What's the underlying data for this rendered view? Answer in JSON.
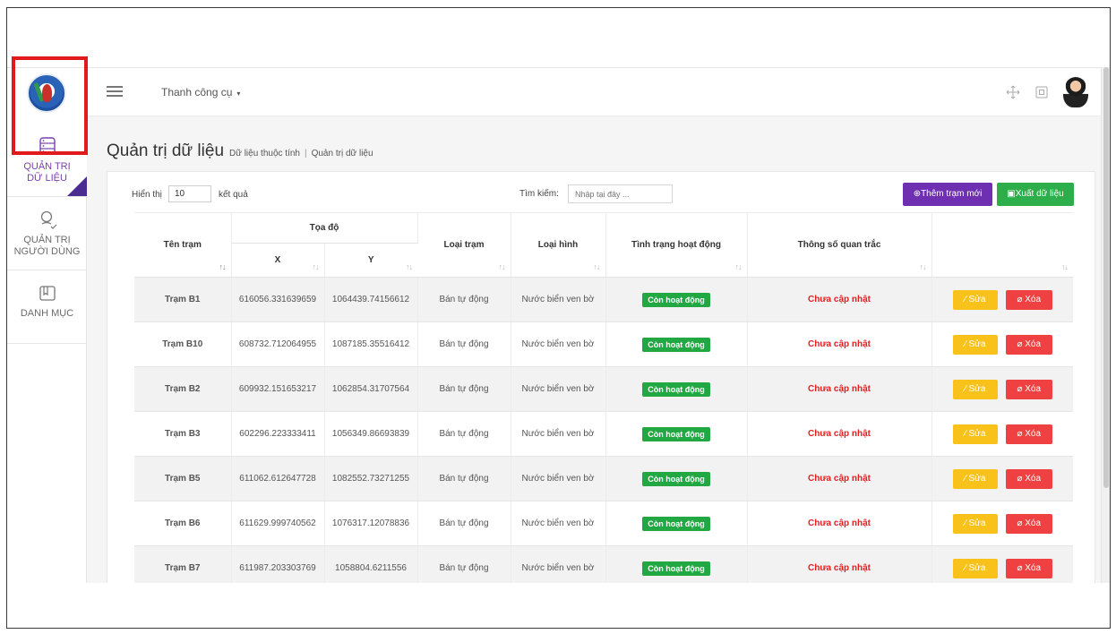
{
  "topbar": {
    "toolbar_label": "Thanh công cụ",
    "caret": "▾"
  },
  "sidebar": {
    "items": [
      {
        "label_line1": "QUẢN TRỊ",
        "label_line2": "DỮ LIỆU",
        "icon": "database-icon",
        "active": true
      },
      {
        "label_line1": "QUẢN TRỊ",
        "label_line2": "NGƯỜI DÙNG",
        "icon": "user-icon",
        "active": false
      },
      {
        "label_line1": "DANH MỤC",
        "label_line2": "",
        "icon": "catalog-icon",
        "active": false
      }
    ]
  },
  "page": {
    "title": "Quản trị dữ liệu",
    "breadcrumb": [
      "Dữ liệu thuộc tính",
      "Quản trị dữ liệu"
    ]
  },
  "controls": {
    "show_label": "Hiển thị",
    "show_value": "10",
    "show_suffix": "kết quả",
    "search_label": "Tìm kiếm:",
    "search_placeholder": "Nhập tại đây ...",
    "add_button": "Thêm trạm mới",
    "export_button": "Xuất dữ liệu"
  },
  "table": {
    "headers": {
      "name": "Tên trạm",
      "coord_group": "Tọa độ",
      "x": "X",
      "y": "Y",
      "station_type": "Loại trạm",
      "kind": "Loại hình",
      "status": "Tình trạng hoạt động",
      "params": "Thông số quan trắc"
    },
    "edit_label": "Sửa",
    "delete_label": "Xóa",
    "rows": [
      {
        "name": "Trạm B1",
        "x": "616056.331639659",
        "y": "1064439.74156612",
        "station_type": "Bán tự động",
        "kind": "Nước biển ven bờ",
        "status": "Còn hoạt động",
        "params": "Chưa cập nhật"
      },
      {
        "name": "Trạm B10",
        "x": "608732.712064955",
        "y": "1087185.35516412",
        "station_type": "Bán tự động",
        "kind": "Nước biển ven bờ",
        "status": "Còn hoạt động",
        "params": "Chưa cập nhật"
      },
      {
        "name": "Trạm B2",
        "x": "609932.151653217",
        "y": "1062854.31707564",
        "station_type": "Bán tự động",
        "kind": "Nước biển ven bờ",
        "status": "Còn hoạt động",
        "params": "Chưa cập nhật"
      },
      {
        "name": "Trạm B3",
        "x": "602296.223333411",
        "y": "1056349.86693839",
        "station_type": "Bán tự động",
        "kind": "Nước biển ven bờ",
        "status": "Còn hoạt động",
        "params": "Chưa cập nhật"
      },
      {
        "name": "Trạm B5",
        "x": "611062.612647728",
        "y": "1082552.73271255",
        "station_type": "Bán tự động",
        "kind": "Nước biển ven bờ",
        "status": "Còn hoạt động",
        "params": "Chưa cập nhật"
      },
      {
        "name": "Trạm B6",
        "x": "611629.999740562",
        "y": "1076317.12078836",
        "station_type": "Bán tự động",
        "kind": "Nước biển ven bờ",
        "status": "Còn hoạt động",
        "params": "Chưa cập nhật"
      },
      {
        "name": "Trạm B7",
        "x": "611987.203303769",
        "y": "1058804.6211556",
        "station_type": "Bán tự động",
        "kind": "Nước biển ven bờ",
        "status": "Còn hoạt động",
        "params": "Chưa cập nhật"
      }
    ]
  },
  "colors": {
    "accent_purple": "#6f2fb1",
    "export_green": "#2eae4a",
    "status_green": "#21a842",
    "warning_red": "#e21f1f",
    "edit_yellow": "#f8c21b",
    "delete_red": "#ef4141",
    "highlight_red": "#e11b1b"
  }
}
